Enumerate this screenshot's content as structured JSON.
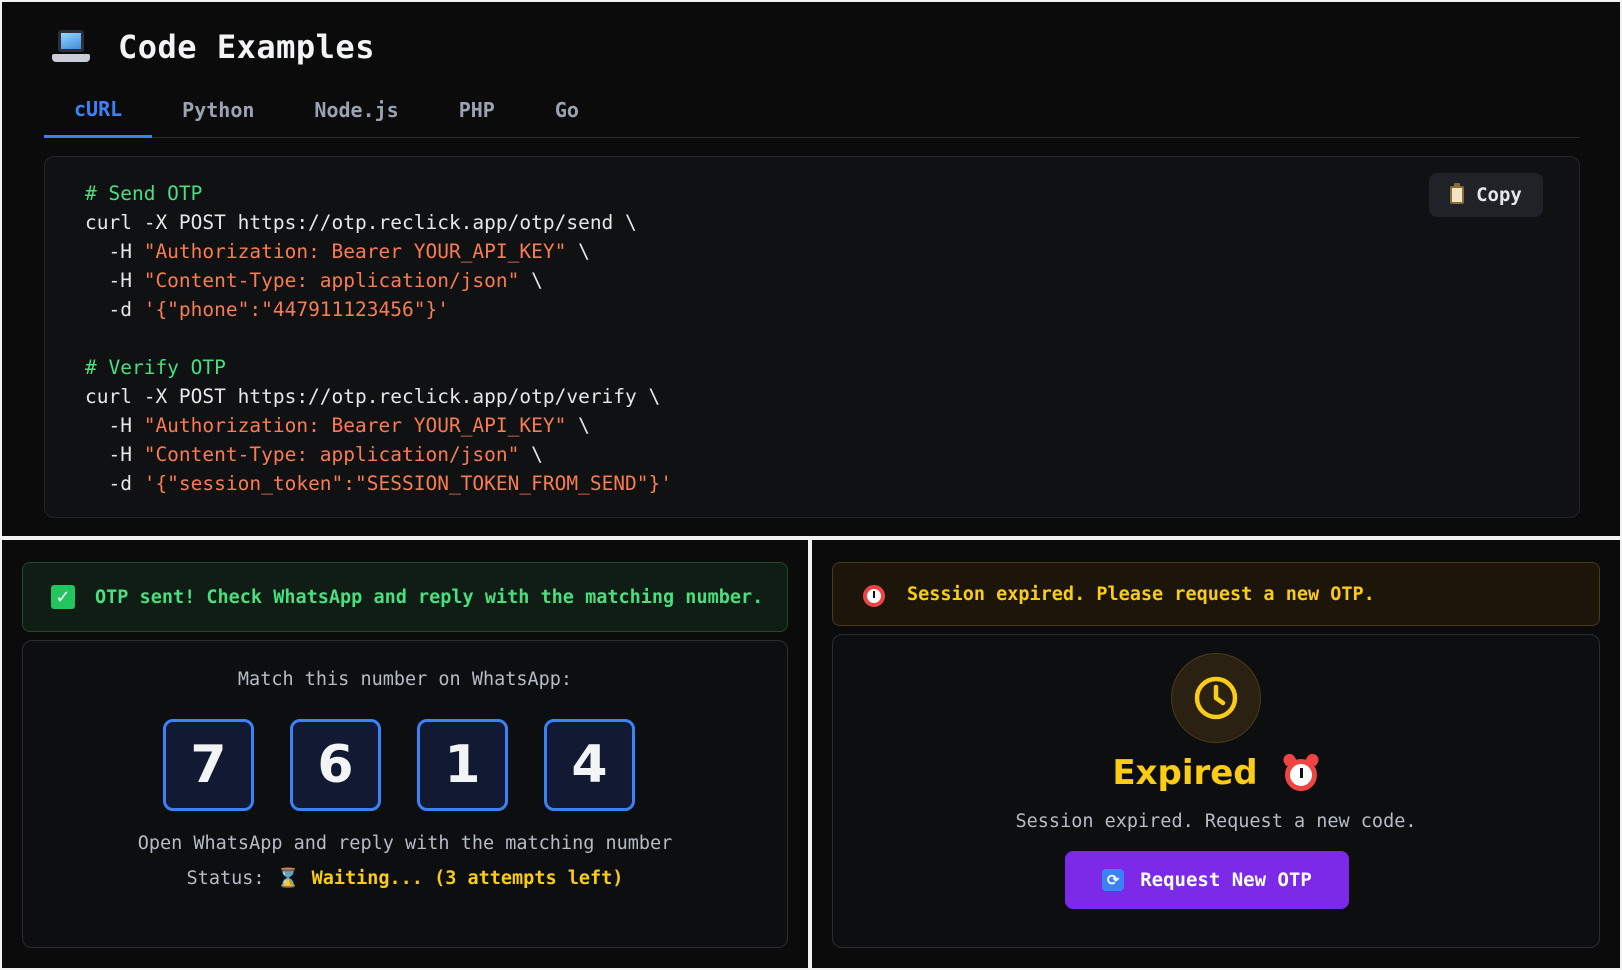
{
  "header": {
    "title": "Code Examples",
    "icon": "laptop-icon"
  },
  "tabs": [
    {
      "label": "cURL",
      "active": true
    },
    {
      "label": "Python",
      "active": false
    },
    {
      "label": "Node.js",
      "active": false
    },
    {
      "label": "PHP",
      "active": false
    },
    {
      "label": "Go",
      "active": false
    }
  ],
  "code": {
    "copy_label": "Copy",
    "send_comment": "# Send OTP",
    "send_cmd": "curl -X POST https://otp.reclick.app/otp/send \\",
    "send_h1_flag": "  -H ",
    "send_h1": "\"Authorization: Bearer YOUR_API_KEY\"",
    "send_h2_flag": "  -H ",
    "send_h2": "\"Content-Type: application/json\"",
    "send_d_flag": "  -d ",
    "send_d": "'{\"phone\":\"447911123456\"}'",
    "verify_comment": "# Verify OTP",
    "verify_cmd": "curl -X POST https://otp.reclick.app/otp/verify \\",
    "verify_h1_flag": "  -H ",
    "verify_h1": "\"Authorization: Bearer YOUR_API_KEY\"",
    "verify_h2_flag": "  -H ",
    "verify_h2": "\"Content-Type: application/json\"",
    "verify_d_flag": "  -d ",
    "verify_d": "'{\"session_token\":\"SESSION_TOKEN_FROM_SEND\"}'",
    "line_cont": " \\"
  },
  "sent": {
    "message": "OTP sent! Check WhatsApp and reply with the matching number.",
    "match_label": "Match this number on WhatsApp:",
    "digits": [
      "7",
      "6",
      "1",
      "4"
    ],
    "hint": "Open WhatsApp and reply with the matching number",
    "status_label": "Status:",
    "status_value": "Waiting... (3 attempts left)"
  },
  "expired": {
    "message": "Session expired. Please request a new OTP.",
    "title": "Expired",
    "subtitle": "Session expired. Request a new code.",
    "button_label": "Request New OTP"
  },
  "colors": {
    "accent_blue": "#3b82f6",
    "success_green": "#4ade80",
    "warning_yellow": "#facc15",
    "button_purple": "#7c2ae8",
    "string_orange": "#f87c52"
  }
}
